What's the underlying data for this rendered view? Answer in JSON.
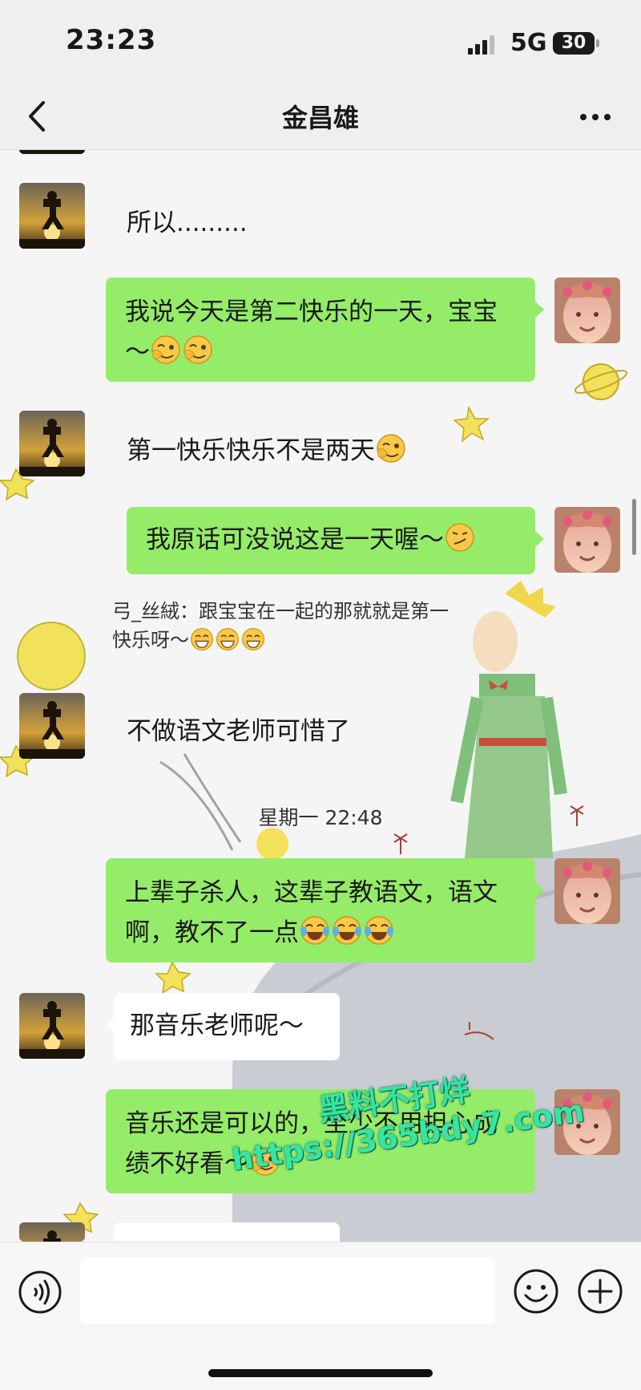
{
  "status_bar": {
    "time": "23:23",
    "network": "5G",
    "battery": "30"
  },
  "nav": {
    "title": "金昌雄"
  },
  "messages": {
    "m1": "所以.........",
    "m2": "我说今天是第二快乐的一天，宝宝～",
    "m3": "第一快乐快乐不是两天",
    "m4": "我原话可没说这是一天喔～",
    "quote_sender": "弓_丝絨：",
    "quote_text_line1": "跟宝宝在一起的那就就是第一",
    "quote_text_line2": "快乐呀～",
    "m5": "不做语文老师可惜了",
    "timestamp": "星期一 22:48",
    "m6": "上辈子杀人，这辈子教语文，语文啊，教不了一点",
    "m7": "那音乐老师呢～",
    "m8": "音乐还是可以的，至少不用担心成绩不好看～"
  },
  "watermark": {
    "line1": "黑料不打烊",
    "line2": "https://365bdy7.com"
  },
  "colors": {
    "self_bubble": "#95ec69",
    "other_bubble": "#ffffff",
    "background": "#ededed"
  }
}
